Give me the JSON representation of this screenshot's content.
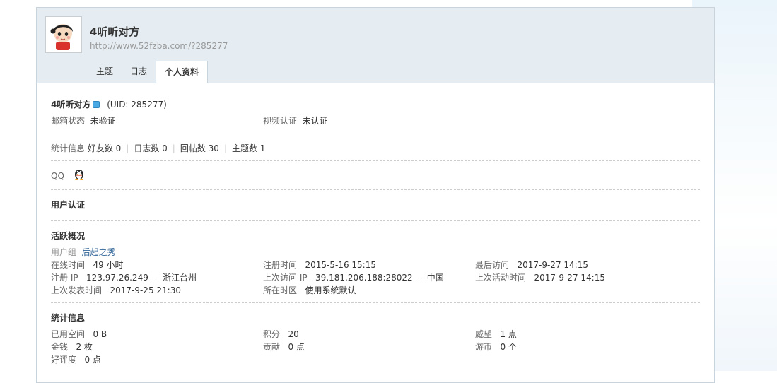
{
  "profile": {
    "username": "4听听对方",
    "url": "http://www.52fzba.com/?285277",
    "uid_text": "(UID: 285277)"
  },
  "tabs": [
    "主题",
    "日志",
    "个人资料"
  ],
  "info": {
    "email_label": "邮箱状态",
    "email_value": "未验证",
    "video_label": "视频认证",
    "video_value": "未认证",
    "stats_label": "统计信息",
    "friends": "好友数 0",
    "logs": "日志数 0",
    "replies": "回帖数 30",
    "threads": "主题数 1",
    "qq_label": "QQ"
  },
  "sections": {
    "verify_title": "用户认证",
    "activity_title": "活跃概况",
    "stats_title": "统计信息"
  },
  "activity": {
    "group_label": "用户组",
    "group_value": "后起之秀",
    "online_label": "在线时间",
    "online_value": "49 小时",
    "reg_time_label": "注册时间",
    "reg_time_value": "2015-5-16 15:15",
    "last_visit_label": "最后访问",
    "last_visit_value": "2017-9-27 14:15",
    "reg_ip_label": "注册 IP",
    "reg_ip_value": "123.97.26.249 - - 浙江台州",
    "last_ip_label": "上次访问 IP",
    "last_ip_value": "39.181.206.188:28022 - - 中国",
    "last_active_label": "上次活动时间",
    "last_active_value": "2017-9-27 14:15",
    "last_post_label": "上次发表时间",
    "last_post_value": "2017-9-25 21:30",
    "timezone_label": "所在时区",
    "timezone_value": "使用系统默认"
  },
  "stats": {
    "space_label": "已用空间",
    "space_value": "0 B",
    "points_label": "积分",
    "points_value": "20",
    "prestige_label": "威望",
    "prestige_value": "1 点",
    "money_label": "金钱",
    "money_value": "2 枚",
    "contrib_label": "贡献",
    "contrib_value": "0 点",
    "coins_label": "游币",
    "coins_value": "0 个",
    "rating_label": "好评度",
    "rating_value": "0 点"
  }
}
